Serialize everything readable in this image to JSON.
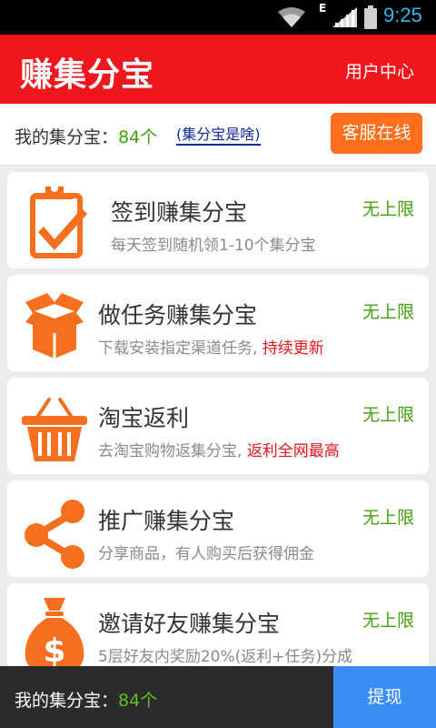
{
  "status_bar": {
    "network_type": "E",
    "time": "9:25"
  },
  "app_bar": {
    "title": "赚集分宝",
    "user_center": "用户中心"
  },
  "summary": {
    "label": "我的集分宝：",
    "count": "84个",
    "what_link": "(集分宝是啥)",
    "service_button": "客服在线"
  },
  "items": [
    {
      "icon": "clipboard-check-icon",
      "title": "签到赚集分宝",
      "desc": "每天签到随机领1-10个集分宝",
      "desc_highlight": "",
      "limit": "无上限"
    },
    {
      "icon": "open-box-icon",
      "title": "做任务赚集分宝",
      "desc": "下载安装指定渠道任务, ",
      "desc_highlight": "持续更新",
      "limit": "无上限"
    },
    {
      "icon": "shopping-basket-icon",
      "title": "淘宝返利",
      "desc": "去淘宝购物返集分宝, ",
      "desc_highlight": "返利全网最高",
      "limit": "无上限"
    },
    {
      "icon": "share-icon",
      "title": "推广赚集分宝",
      "desc": "分享商品，有人购买后获得佣金",
      "desc_highlight": "",
      "limit": "无上限"
    },
    {
      "icon": "money-bag-icon",
      "title": "邀请好友赚集分宝",
      "desc": "5层好友内奖励20%(返利+任务)分成",
      "desc_highlight": "",
      "limit": "无上限"
    }
  ],
  "bottom_bar": {
    "label": "我的集分宝：",
    "count": "84个",
    "withdraw_button": "提现"
  },
  "colors": {
    "brand_red": "#f0161d",
    "accent_orange": "#ff6e1b",
    "icon_orange": "#f5701e",
    "green": "#43a010",
    "highlight_red": "#e3141b",
    "withdraw_blue": "#3a8df4"
  }
}
